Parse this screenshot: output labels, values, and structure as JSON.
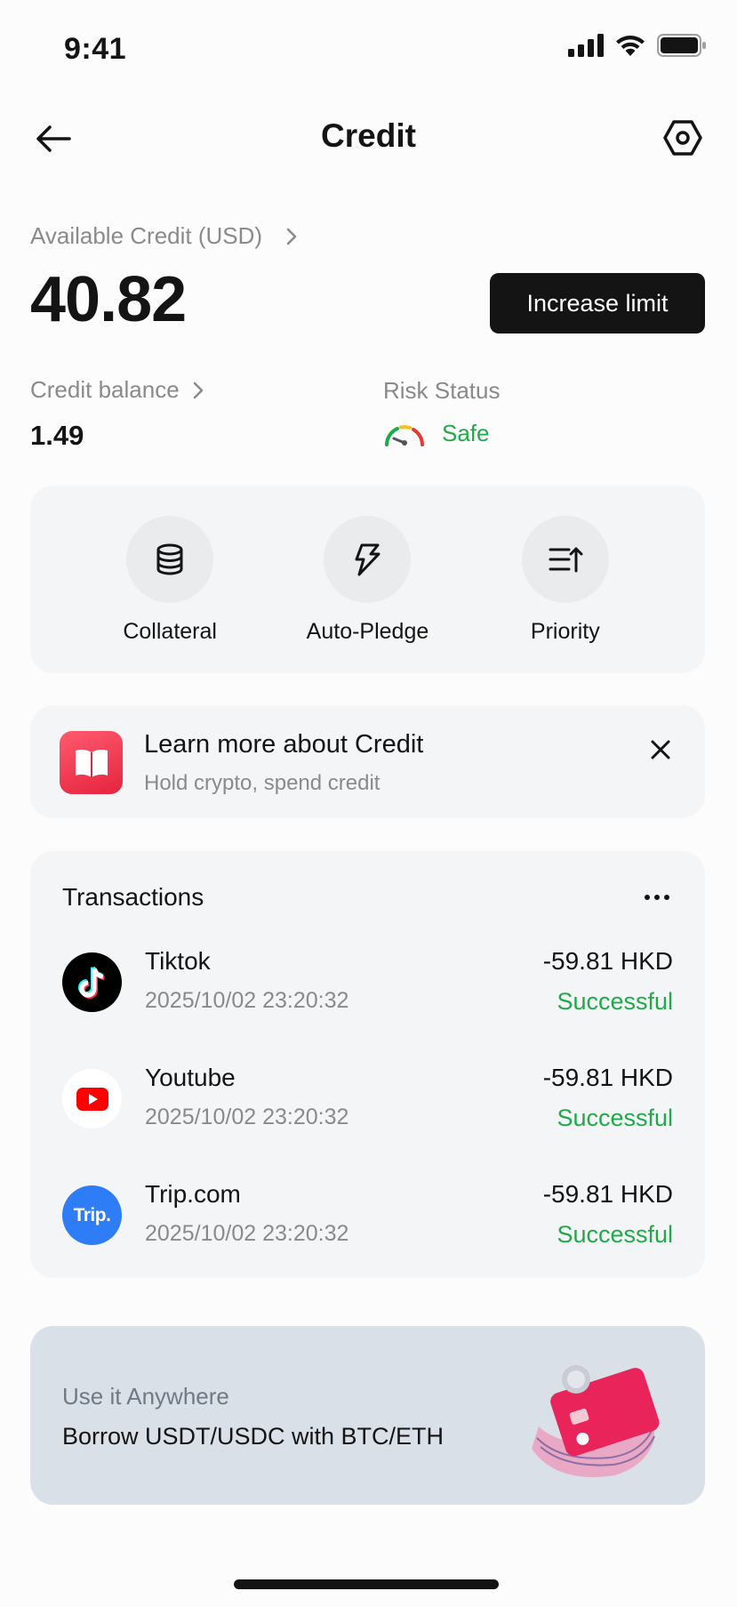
{
  "status_bar": {
    "time": "9:41"
  },
  "header": {
    "title": "Credit"
  },
  "credit": {
    "available_label": "Available Credit (USD)",
    "available_value": "40.82",
    "increase_label": "Increase limit",
    "balance_label": "Credit balance",
    "balance_value": "1.49",
    "risk_label": "Risk Status",
    "risk_value": "Safe"
  },
  "actions": [
    {
      "label": "Collateral",
      "icon": "database-icon"
    },
    {
      "label": "Auto-Pledge",
      "icon": "lightning-icon"
    },
    {
      "label": "Priority",
      "icon": "sort-priority-icon"
    }
  ],
  "learn": {
    "title": "Learn more about Credit",
    "subtitle": "Hold crypto, spend credit"
  },
  "transactions": {
    "title": "Transactions",
    "items": [
      {
        "name": "Tiktok",
        "date": "2025/10/02 23:20:32",
        "amount": "-59.81 HKD",
        "status": "Successful",
        "logo": "tiktok-logo"
      },
      {
        "name": "Youtube",
        "date": "2025/10/02 23:20:32",
        "amount": "-59.81 HKD",
        "status": "Successful",
        "logo": "youtube-logo"
      },
      {
        "name": "Trip.com",
        "date": "2025/10/02 23:20:32",
        "amount": "-59.81 HKD",
        "status": "Successful",
        "logo": "trip-logo",
        "logo_text": "Trip."
      }
    ]
  },
  "promo": {
    "subtitle": "Use it Anywhere",
    "title": "Borrow USDT/USDC with BTC/ETH"
  },
  "colors": {
    "success": "#1faa4a",
    "primary_button": "#141414",
    "card_bg": "#f4f5f6",
    "promo_bg": "#d9e0e7",
    "learn_icon": "#e5243d",
    "trip_blue": "#2f7df6",
    "youtube_red": "#ff0000"
  }
}
